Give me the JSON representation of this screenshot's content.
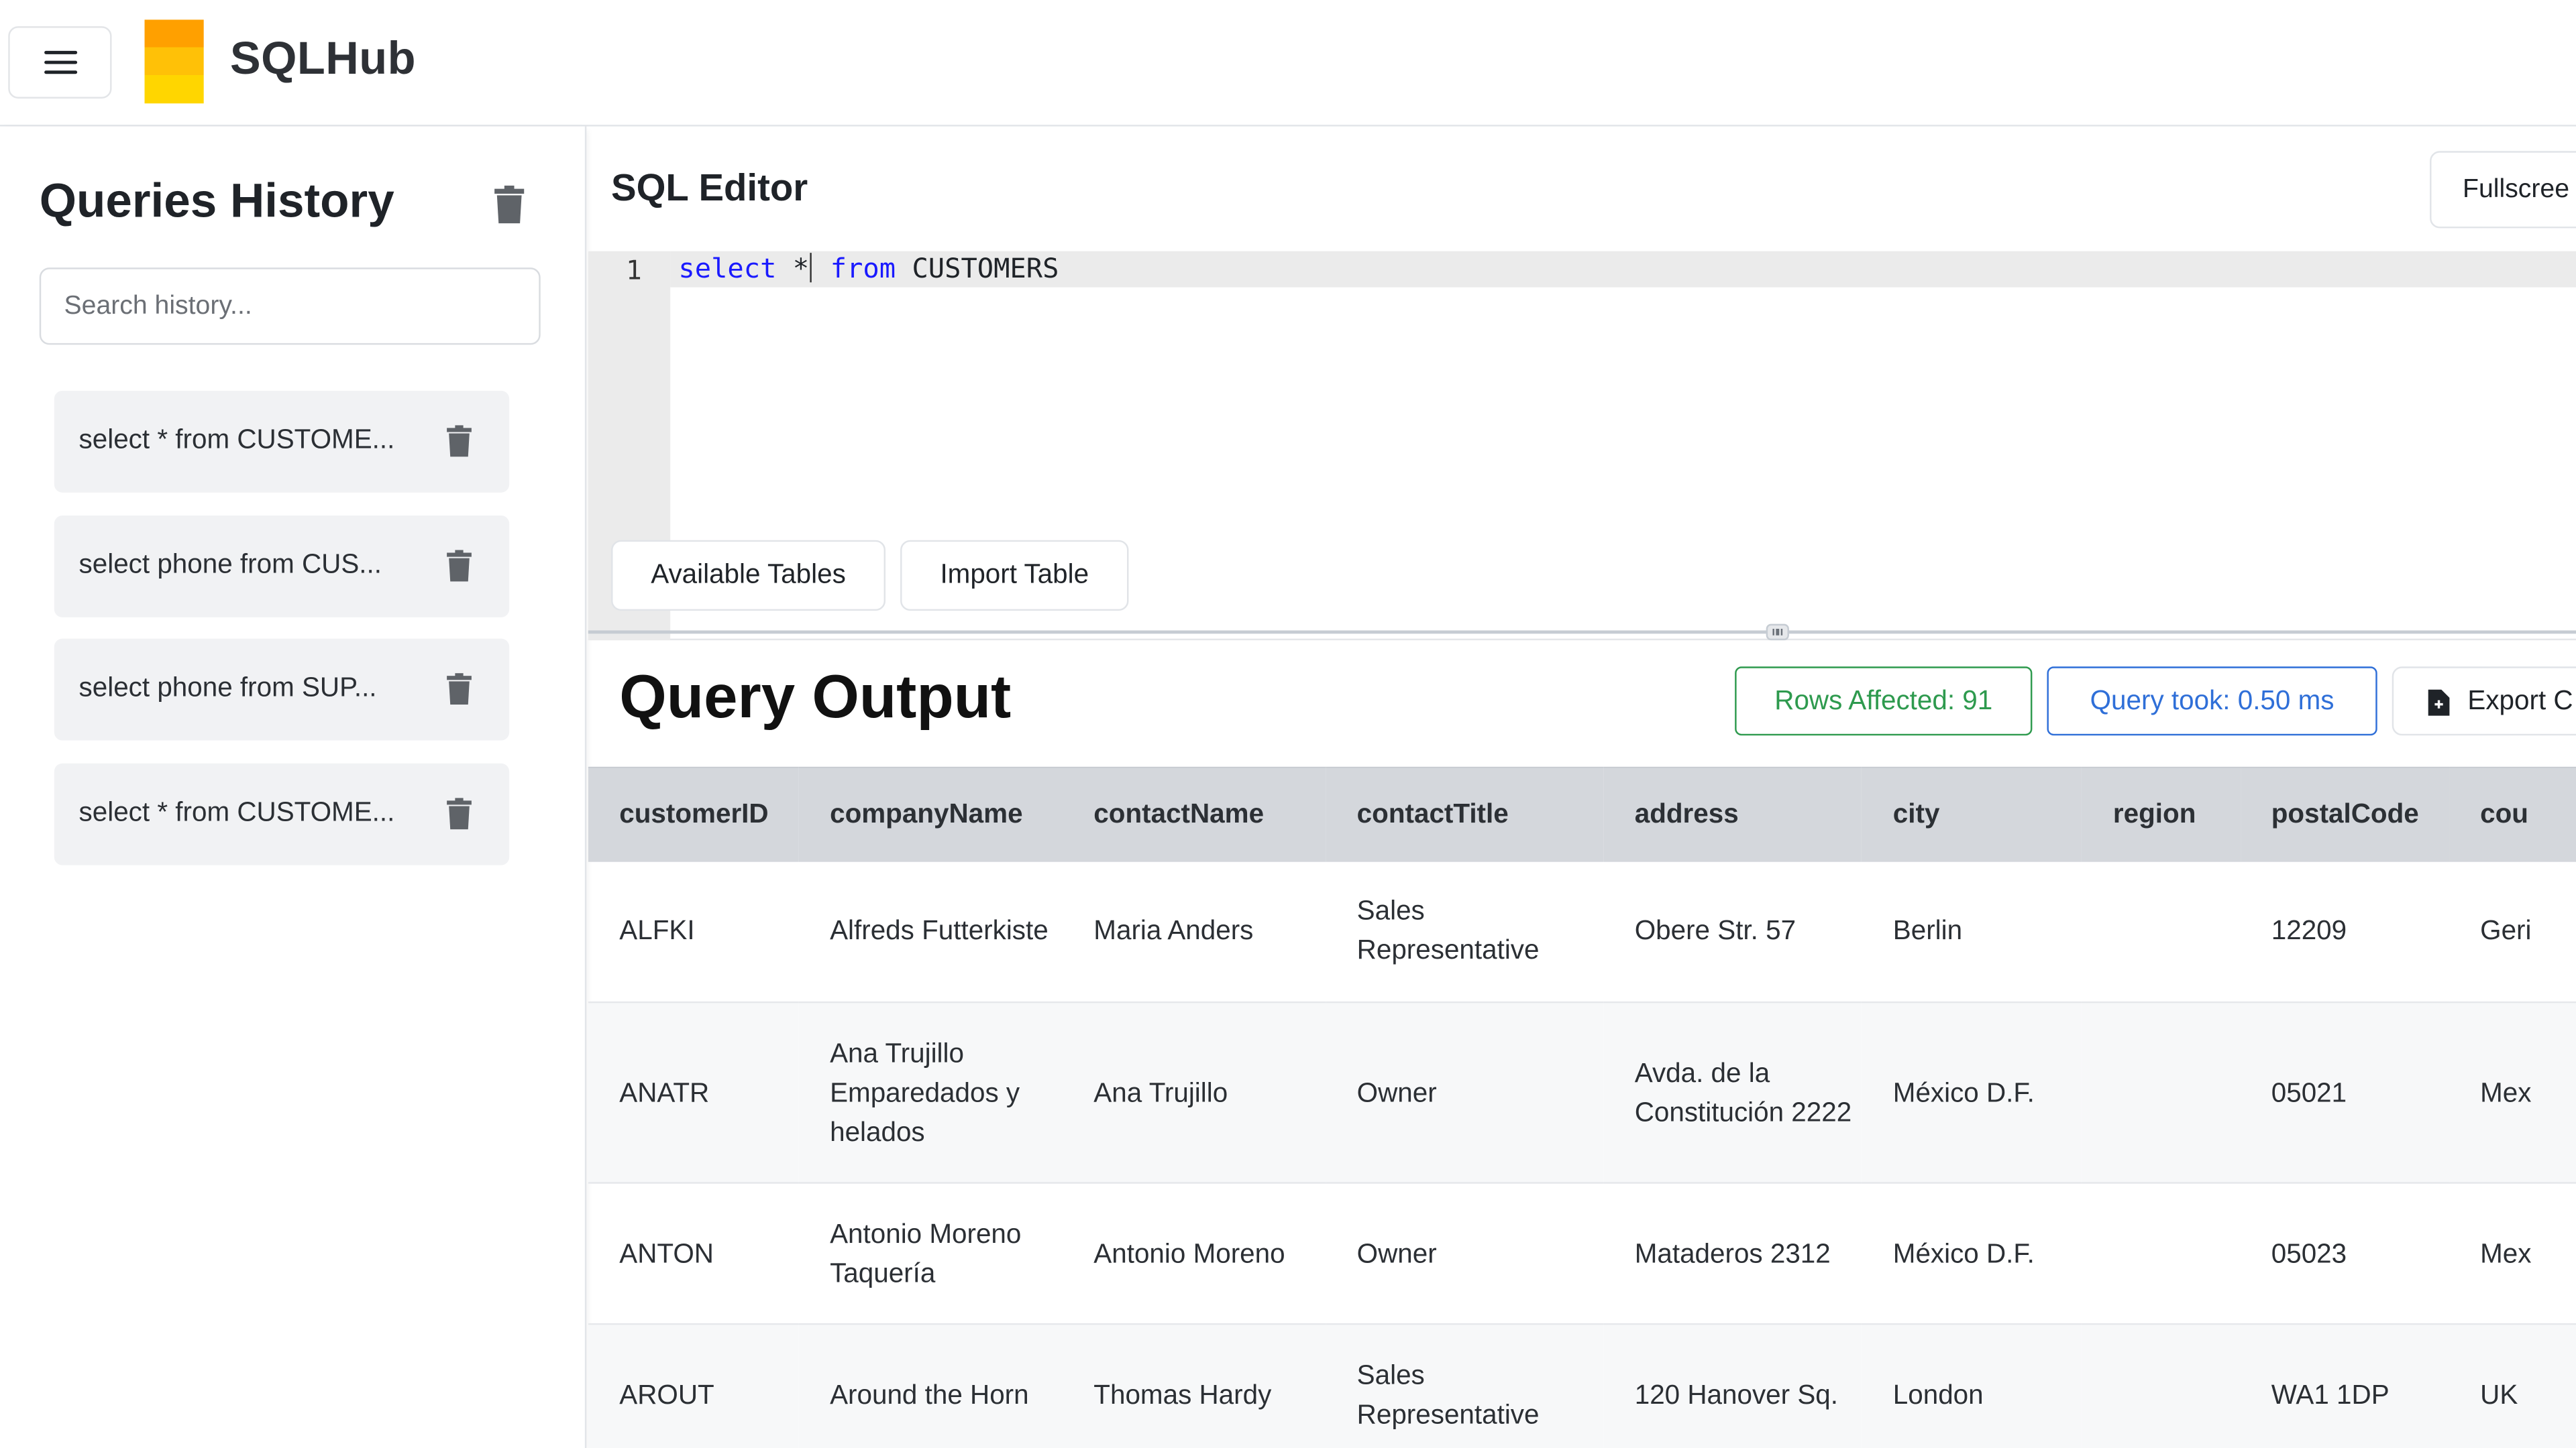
{
  "app": {
    "title": "SQLHub"
  },
  "sidebar": {
    "title": "Queries History",
    "search_placeholder": "Search history...",
    "items": [
      {
        "label": "select * from CUSTOME..."
      },
      {
        "label": "select phone from CUS..."
      },
      {
        "label": "select phone from SUP..."
      },
      {
        "label": "select * from CUSTOME..."
      }
    ]
  },
  "editor": {
    "title": "SQL Editor",
    "fullscreen_label": "Fullscree",
    "line_number": "1",
    "code": {
      "kw1": "select",
      "star": "*",
      "kw2": "from",
      "table": "CUSTOMERS"
    },
    "available_tables_label": "Available Tables",
    "import_table_label": "Import Table"
  },
  "output": {
    "title": "Query Output",
    "rows_affected": "Rows Affected: 91",
    "query_time": "Query took: 0.50 ms",
    "export_label": "Export C"
  },
  "table": {
    "columns": [
      "customerID",
      "companyName",
      "contactName",
      "contactTitle",
      "address",
      "city",
      "region",
      "postalCode",
      "cou"
    ],
    "rows": [
      [
        "ALFKI",
        "Alfreds Futterkiste",
        "Maria Anders",
        "Sales Representative",
        "Obere Str. 57",
        "Berlin",
        "",
        "12209",
        "Geri"
      ],
      [
        "ANATR",
        "Ana Trujillo Emparedados y helados",
        "Ana Trujillo",
        "Owner",
        "Avda. de la Constitución 2222",
        "México D.F.",
        "",
        "05021",
        "Mex"
      ],
      [
        "ANTON",
        "Antonio Moreno Taquería",
        "Antonio Moreno",
        "Owner",
        "Mataderos 2312",
        "México D.F.",
        "",
        "05023",
        "Mex"
      ],
      [
        "AROUT",
        "Around the Horn",
        "Thomas Hardy",
        "Sales Representative",
        "120 Hanover Sq.",
        "London",
        "",
        "WA1 1DP",
        "UK"
      ]
    ]
  },
  "colors": {
    "logo": "#ffc107",
    "rows_badge": "#2e9a4e",
    "time_badge": "#2f6fd8",
    "keyword": "#1a1aff",
    "table_header": "#d4d7dc"
  },
  "icons": [
    "menu-icon",
    "logo-icon",
    "trash-icon",
    "file-icon",
    "drag-handle-icon"
  ]
}
